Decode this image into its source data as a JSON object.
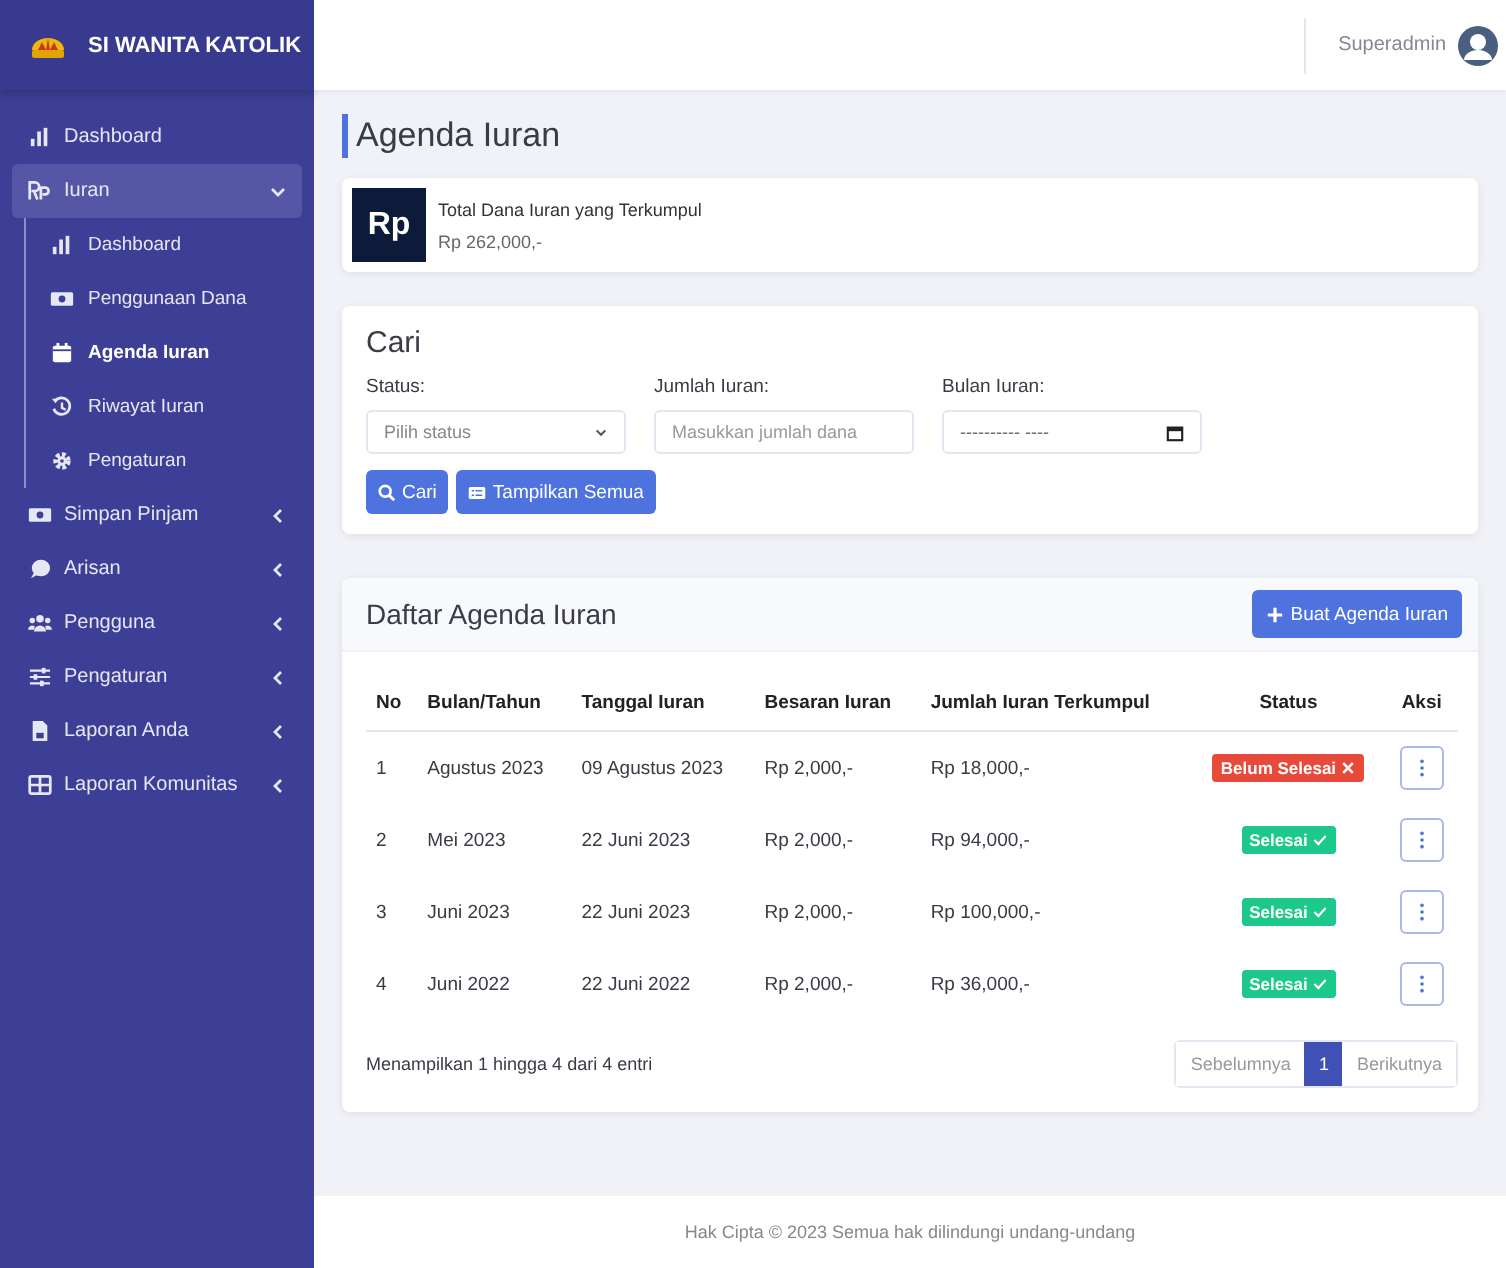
{
  "brand": {
    "title": "SI WANITA KATOLIK"
  },
  "topbar": {
    "user": "Superadmin"
  },
  "sidebar": {
    "items": [
      {
        "label": "Dashboard",
        "selected": false
      },
      {
        "label": "Iuran",
        "selected": false,
        "expanded": true,
        "children": [
          {
            "label": "Dashboard",
            "selected": false
          },
          {
            "label": "Penggunaan Dana",
            "selected": false
          },
          {
            "label": "Agenda Iuran",
            "selected": true
          },
          {
            "label": "Riwayat Iuran",
            "selected": false
          },
          {
            "label": "Pengaturan",
            "selected": false
          }
        ]
      },
      {
        "label": "Simpan Pinjam",
        "selected": false,
        "expanded": false
      },
      {
        "label": "Arisan",
        "selected": false,
        "expanded": false
      },
      {
        "label": "Pengguna",
        "selected": false,
        "expanded": false
      },
      {
        "label": "Pengaturan",
        "selected": false,
        "expanded": false
      },
      {
        "label": "Laporan Anda",
        "selected": false,
        "expanded": false
      },
      {
        "label": "Laporan Komunitas",
        "selected": false,
        "expanded": false
      }
    ]
  },
  "page_title": "Agenda Iuran",
  "summary": {
    "badge": "Rp",
    "label": "Total Dana Iuran yang Terkumpul",
    "value": "Rp 262,000,-"
  },
  "search": {
    "title": "Cari",
    "fields": [
      {
        "kind": "select",
        "label": "Status:",
        "placeholder": "Pilih status"
      },
      {
        "kind": "text",
        "label": "Jumlah Iuran:",
        "placeholder": "Masukkan jumlah dana"
      },
      {
        "kind": "month",
        "label": "Bulan Iuran:",
        "placeholder": "---------- ----"
      }
    ],
    "buttons": [
      {
        "kind": "search",
        "label": "Cari"
      },
      {
        "kind": "list",
        "label": "Tampilkan Semua"
      }
    ]
  },
  "table": {
    "title": "Daftar Agenda Iuran",
    "add_button": "Buat Agenda Iuran",
    "columns": [
      "No",
      "Bulan/Tahun",
      "Tanggal Iuran",
      "Besaran Iuran",
      "Jumlah Iuran Terkumpul",
      "Status",
      "Aksi"
    ],
    "rows": [
      {
        "no": "1",
        "month": "Agustus 2023",
        "date": "09 Agustus 2023",
        "amount": "Rp 2,000,-",
        "collected": "Rp 18,000,-",
        "status": "Belum Selesai",
        "done": false
      },
      {
        "no": "2",
        "month": "Mei 2023",
        "date": "22 Juni 2023",
        "amount": "Rp 2,000,-",
        "collected": "Rp 94,000,-",
        "status": "Selesai",
        "done": true
      },
      {
        "no": "3",
        "month": "Juni 2023",
        "date": "22 Juni 2023",
        "amount": "Rp 2,000,-",
        "collected": "Rp 100,000,-",
        "status": "Selesai",
        "done": true
      },
      {
        "no": "4",
        "month": "Juni 2022",
        "date": "22 Juni 2022",
        "amount": "Rp 2,000,-",
        "collected": "Rp 36,000,-",
        "status": "Selesai",
        "done": true
      }
    ],
    "info": "Menampilkan 1 hingga 4 dari 4 entri",
    "pagination": [
      {
        "label": "Sebelumnya",
        "selected": false
      },
      {
        "label": "1",
        "selected": true
      },
      {
        "label": "Berikutnya",
        "selected": false
      }
    ]
  },
  "footer": "Hak Cipta © 2023 Semua hak dilindungi undang-undang"
}
